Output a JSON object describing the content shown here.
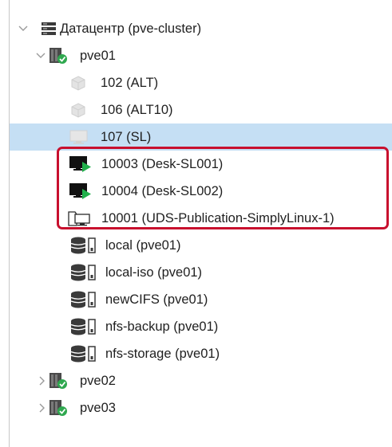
{
  "tree": {
    "datacenter": {
      "label": "Датацентр (pve-cluster)",
      "icon": "server-stack-icon",
      "expanded": true
    },
    "nodes": [
      {
        "label": "pve01",
        "icon": "node-online-icon",
        "expanded": true,
        "children": [
          {
            "label": "102 (ALT)",
            "icon": "container-stopped-icon"
          },
          {
            "label": "106 (ALT10)",
            "icon": "container-stopped-icon"
          },
          {
            "label": "107 (SL)",
            "icon": "vm-stopped-icon",
            "selected": true
          },
          {
            "label": "10003 (Desk-SL001)",
            "icon": "vm-running-icon"
          },
          {
            "label": "10004 (Desk-SL002)",
            "icon": "vm-running-icon"
          },
          {
            "label": "10001 (UDS-Publication-SimplyLinux-1)",
            "icon": "vm-template-icon"
          },
          {
            "label": "local (pve01)",
            "icon": "storage-icon"
          },
          {
            "label": "local-iso (pve01)",
            "icon": "storage-icon"
          },
          {
            "label": "newCIFS (pve01)",
            "icon": "storage-icon"
          },
          {
            "label": "nfs-backup (pve01)",
            "icon": "storage-icon"
          },
          {
            "label": "nfs-storage (pve01)",
            "icon": "storage-icon"
          }
        ]
      },
      {
        "label": "pve02",
        "icon": "node-online-icon",
        "expanded": false
      },
      {
        "label": "pve03",
        "icon": "node-online-icon",
        "expanded": false
      }
    ]
  },
  "colors": {
    "selection": "#c5dff4",
    "highlight_border": "#c8102e",
    "running_arrow": "#21b04b",
    "node_check": "#2fa84f"
  }
}
